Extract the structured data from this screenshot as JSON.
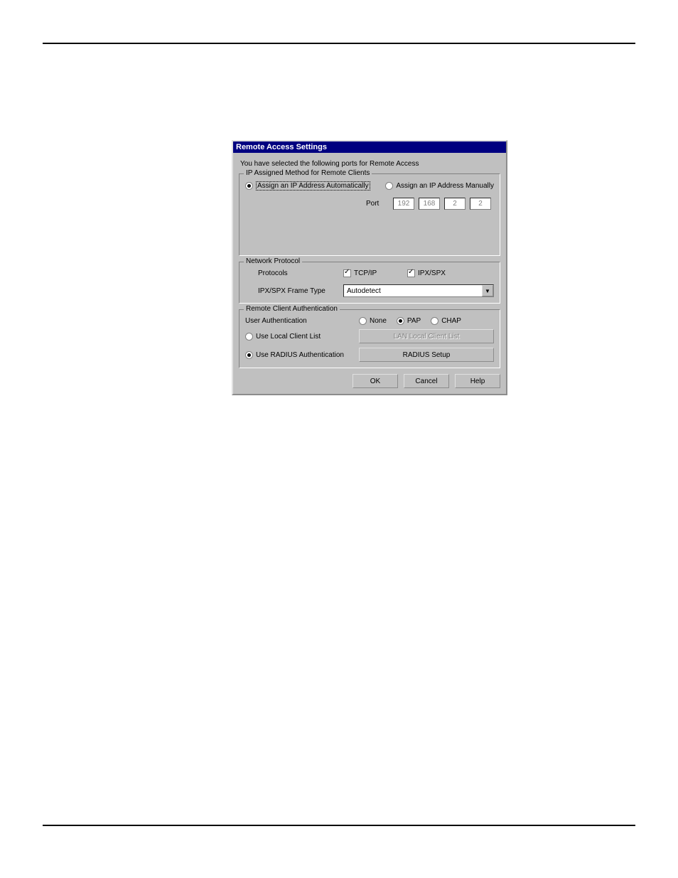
{
  "dialog": {
    "title": "Remote Access Settings",
    "intro": "You have selected the following ports for Remote Access"
  },
  "ip_group": {
    "legend": "IP Assigned Method for Remote Clients",
    "auto_label": "Assign an IP Address Automatically",
    "manual_label": "Assign an IP Address Manually",
    "port_label": "Port",
    "octets": [
      "192",
      "168",
      "2",
      "2"
    ],
    "selected": "auto"
  },
  "proto_group": {
    "legend": "Network Protocol",
    "protocols_label": "Protocols",
    "tcpip_label": "TCP/IP",
    "ipxspx_label": "IPX/SPX",
    "tcpip_checked": true,
    "ipxspx_checked": true,
    "frame_label": "IPX/SPX Frame Type",
    "frame_value": "Autodetect"
  },
  "auth_group": {
    "legend": "Remote Client Authentication",
    "user_auth_label": "User Authentication",
    "none_label": "None",
    "pap_label": "PAP",
    "chap_label": "CHAP",
    "auth_selected": "pap",
    "local_label": "Use Local Client List",
    "radius_label": "Use RADIUS Authentication",
    "source_selected": "radius",
    "local_btn": "LAN Local Client List",
    "radius_btn": "RADIUS Setup"
  },
  "buttons": {
    "ok": "OK",
    "cancel": "Cancel",
    "help": "Help"
  }
}
